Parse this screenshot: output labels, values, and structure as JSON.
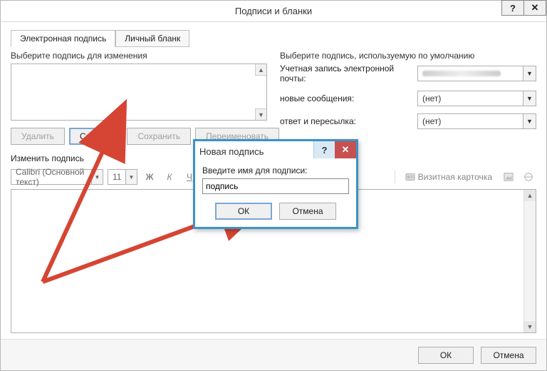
{
  "window": {
    "title": "Подписи и бланки",
    "help": "?",
    "close": "✕"
  },
  "tabs": {
    "signature": "Электронная подпись",
    "letterhead": "Личный бланк"
  },
  "left": {
    "selectLabel": "Выберите подпись для изменения",
    "delete": "Удалить",
    "create": "Создать",
    "save": "Сохранить",
    "rename": "Переименовать"
  },
  "right": {
    "heading": "Выберите подпись, используемую по умолчанию",
    "account": "Учетная запись электронной почты:",
    "newMsg": "новые сообщения:",
    "reply": "ответ и пересылка:",
    "none": "(нет)"
  },
  "edit": {
    "label": "Изменить подпись",
    "font": "Calibri (Основной текст)",
    "size": "11",
    "bold": "Ж",
    "italic": "К",
    "underline": "Ч",
    "card": "Визитная карточка"
  },
  "footer": {
    "ok": "ОК",
    "cancel": "Отмена"
  },
  "modal": {
    "title": "Новая подпись",
    "help": "?",
    "close": "✕",
    "label": "Введите имя для подписи:",
    "value": "подпись",
    "ok": "ОК",
    "cancel": "Отмена"
  }
}
